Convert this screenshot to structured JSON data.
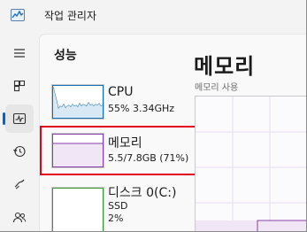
{
  "window": {
    "title": "작업 관리자"
  },
  "nav": {
    "items": [
      {
        "id": "hamburger",
        "icon": "hamburger-menu-icon"
      },
      {
        "id": "processes",
        "icon": "processes-icon"
      },
      {
        "id": "performance",
        "icon": "performance-icon",
        "active": true
      },
      {
        "id": "app-history",
        "icon": "history-icon"
      },
      {
        "id": "startup",
        "icon": "startup-apps-icon"
      },
      {
        "id": "users",
        "icon": "users-icon"
      }
    ]
  },
  "page": {
    "header": "성능"
  },
  "perf_items": [
    {
      "name": "CPU",
      "sub1": "55%  3.34GHz",
      "graph_color": "#1570b8"
    },
    {
      "name": "메모리",
      "sub1": "5.5/7.8GB (71%)",
      "graph_color": "#8b3fa8",
      "selected": true,
      "fill_fraction": 0.71
    },
    {
      "name": "디스크 0(C:)",
      "sub1": "SSD",
      "sub2": "2%",
      "graph_color": "#3a9a3a"
    }
  ],
  "detail": {
    "title": "메모리",
    "subtitle": "메모리 사용"
  },
  "colors": {
    "accent": "#0067c0",
    "highlight": "#e3001b",
    "memory": "#8b3fa8"
  }
}
